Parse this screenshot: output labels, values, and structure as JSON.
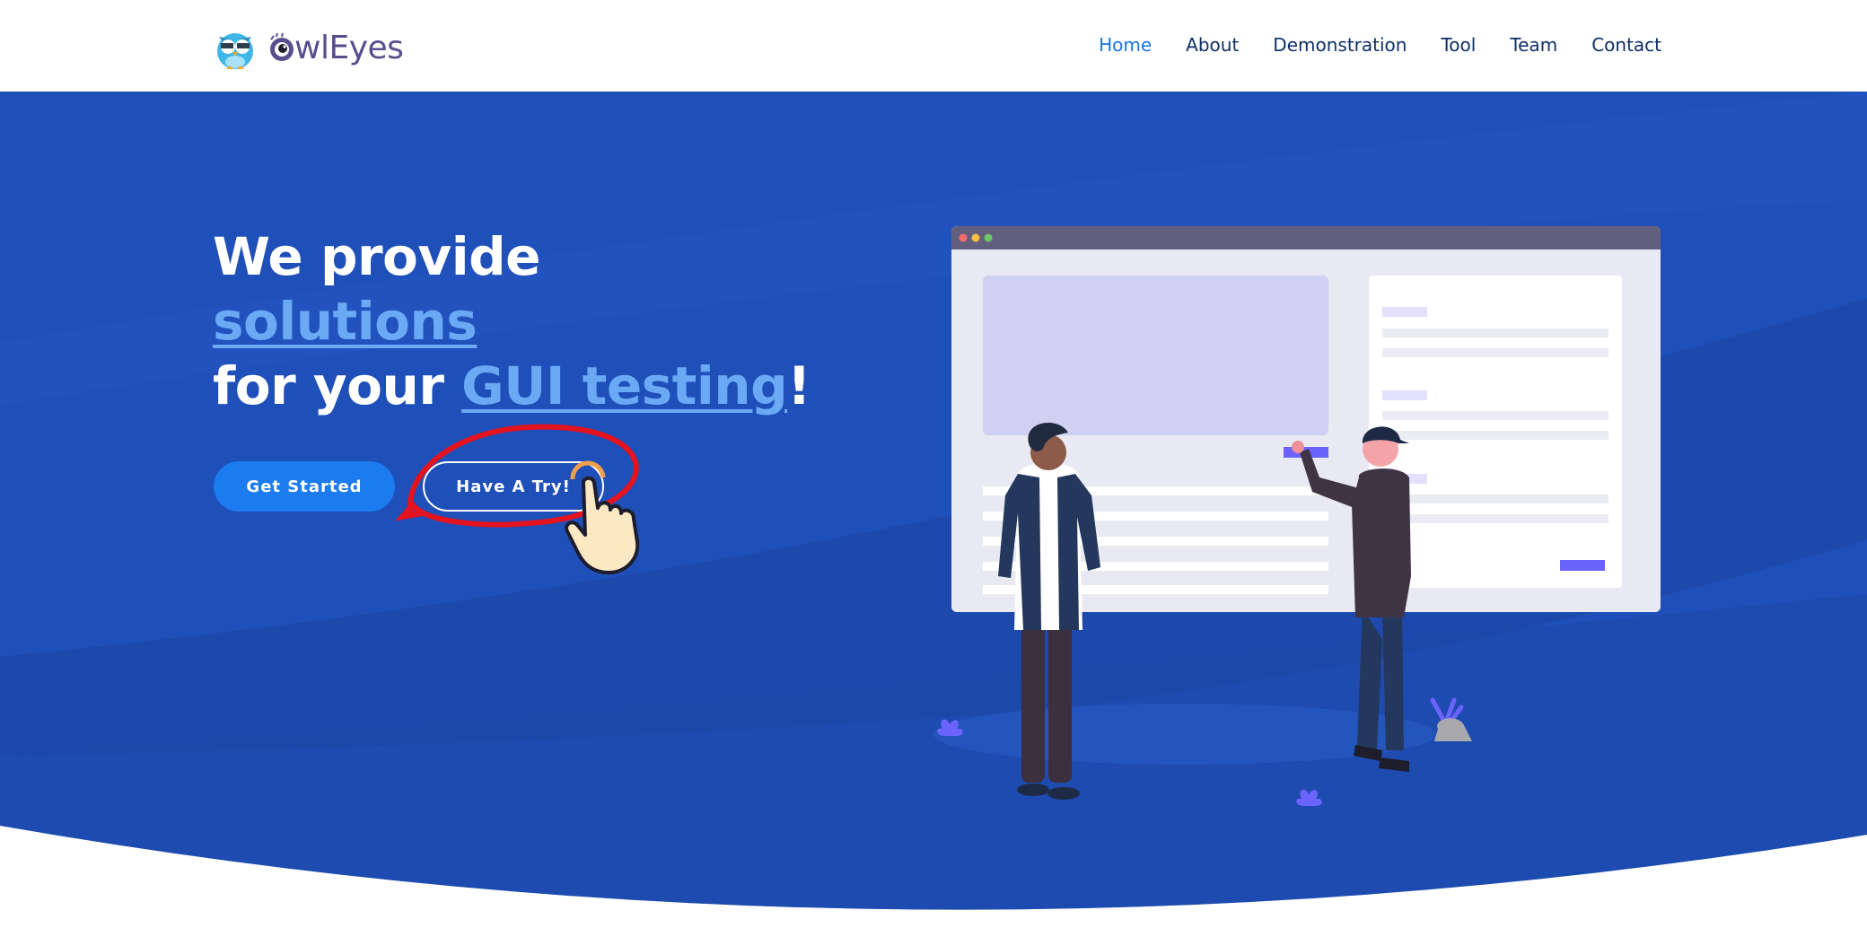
{
  "logo": {
    "text": "wlEyes",
    "icon": "owl-logo-icon"
  },
  "nav": {
    "items": [
      {
        "label": "Home",
        "active": true
      },
      {
        "label": "About",
        "active": false
      },
      {
        "label": "Demonstration",
        "active": false
      },
      {
        "label": "Tool",
        "active": false
      },
      {
        "label": "Team",
        "active": false
      },
      {
        "label": "Contact",
        "active": false
      }
    ]
  },
  "hero": {
    "line1": "We provide",
    "line2_highlight": "solutions",
    "line3_prefix": "for your ",
    "line3_highlight": "GUI testing",
    "line3_suffix": "!",
    "primary_button": "Get Started",
    "secondary_button": "Have A Try!"
  },
  "colors": {
    "hero_blue": "#1f4fb8",
    "accent_blue": "#1b7bef",
    "highlight_text": "#6ba9f5",
    "nav_text": "#0d2f66",
    "nav_active": "#1b74e4",
    "annotation_red": "#e3141f"
  }
}
